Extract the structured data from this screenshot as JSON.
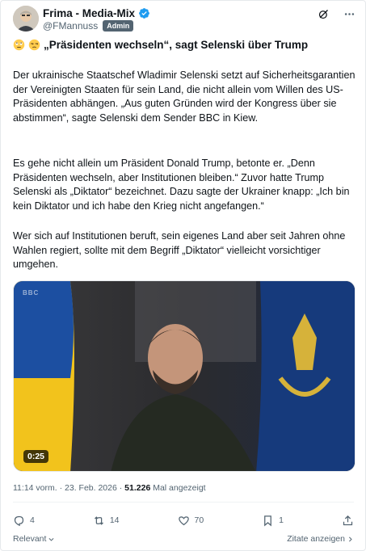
{
  "author": {
    "display_name": "Frima - Media-Mix",
    "handle": "@FMannuss",
    "badge": "Admin",
    "verified": true
  },
  "top_icons": [
    "grok-icon",
    "more-icon"
  ],
  "headline": {
    "emojis": [
      "rolling-eyes-emoji",
      "unamused-emoji"
    ],
    "text": "„Präsidenten wechseln“, sagt Selenski über Trump"
  },
  "body": {
    "paragraph_1": "Der ukrainische Staatschef Wladimir Selenski setzt auf Sicherheitsgarantien der Vereinigten Staaten für sein Land, die nicht allein vom Willen des US-Präsidenten abhängen. „Aus guten Gründen wird der Kongress über sie abstimmen“, sagte Selenski dem Sender BBC in Kiew.",
    "paragraph_2": "Es gehe nicht allein um Präsident Donald Trump, betonte er. „Denn Präsidenten wechseln, aber Institutionen bleiben.“ Zuvor hatte Trump Selenski als „Diktator“ bezeichnet. Dazu sagte der Ukrainer knapp: „Ich bin kein Diktator und ich habe den Krieg nicht angefangen.“",
    "paragraph_3": "Wer sich auf Institutionen beruft, sein eigenes Land aber seit Jahren ohne Wahlen regiert, sollte mit dem Begriff „Diktator“ vielleicht vorsichtiger umgehen."
  },
  "media": {
    "type": "video",
    "duration": "0:25",
    "watermark": "BBC"
  },
  "meta": {
    "time": "11:14 vorm.",
    "separator": " · ",
    "date": "23. Feb. 2026",
    "views": "51.226",
    "views_label": " Mal angezeigt"
  },
  "actions": {
    "replies": "4",
    "reposts": "14",
    "likes": "70",
    "bookmarks": "1"
  },
  "footer": {
    "relevance": "Relevant",
    "quotes": "Zitate anzeigen"
  },
  "colors": {
    "text": "#0f1419",
    "muted": "#536471",
    "verified_blue": "#1d9bf0",
    "badge_bg": "#536471"
  }
}
